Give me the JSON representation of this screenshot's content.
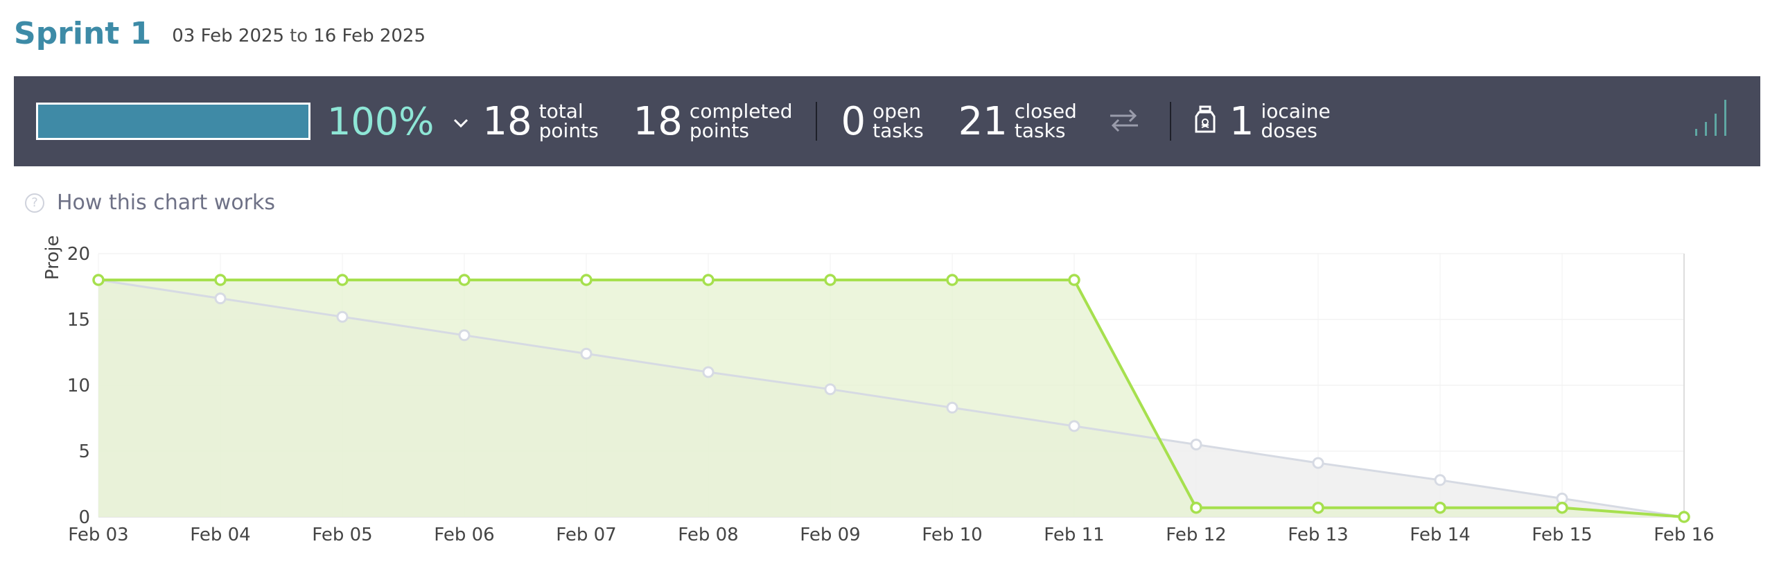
{
  "sprint": {
    "title": "Sprint 1",
    "start_date": "03 Feb 2025",
    "to_word": "to",
    "end_date": "16 Feb 2025"
  },
  "summary": {
    "progress_percent": 100,
    "progress_label": "100%",
    "total_points": {
      "value": "18",
      "label_line1": "total",
      "label_line2": "points"
    },
    "completed_points": {
      "value": "18",
      "label_line1": "completed",
      "label_line2": "points"
    },
    "open_tasks": {
      "value": "0",
      "label_line1": "open",
      "label_line2": "tasks"
    },
    "closed_tasks": {
      "value": "21",
      "label_line1": "closed",
      "label_line2": "tasks"
    },
    "iocaine": {
      "value": "1",
      "label_line1": "iocaine",
      "label_line2": "doses"
    },
    "icons": [
      "chevron-down-icon",
      "swap-arrows-icon",
      "iocaine-jar-icon",
      "bar-chart-icon"
    ]
  },
  "help_link": {
    "label": "How this chart works"
  },
  "colors": {
    "title": "#3d8ba7",
    "bar_bg": "#474a5b",
    "progress_fill": "#3f8aa6",
    "percent": "#8ee6d6",
    "real_line": "#a6e04e",
    "real_fill": "#e6f2d0",
    "ideal_line": "#d6dae3",
    "ideal_fill": "#eeeeee"
  },
  "chart_data": {
    "type": "area",
    "ylabel": "Proje",
    "ylim": [
      0,
      20
    ],
    "yticks": [
      "0",
      "5",
      "10",
      "15",
      "20"
    ],
    "categories": [
      "Feb 03",
      "Feb 04",
      "Feb 05",
      "Feb 06",
      "Feb 07",
      "Feb 08",
      "Feb 09",
      "Feb 10",
      "Feb 11",
      "Feb 12",
      "Feb 13",
      "Feb 14",
      "Feb 15",
      "Feb 16"
    ],
    "series": [
      {
        "key": "ideal",
        "values": [
          18,
          16.6,
          15.2,
          13.8,
          12.4,
          11.0,
          9.7,
          8.3,
          6.9,
          5.5,
          4.1,
          2.8,
          1.4,
          0
        ]
      },
      {
        "key": "real",
        "values": [
          18,
          18,
          18,
          18,
          18,
          18,
          18,
          18,
          18,
          0.7,
          0.7,
          0.7,
          0.7,
          0
        ]
      }
    ],
    "grid": true
  }
}
